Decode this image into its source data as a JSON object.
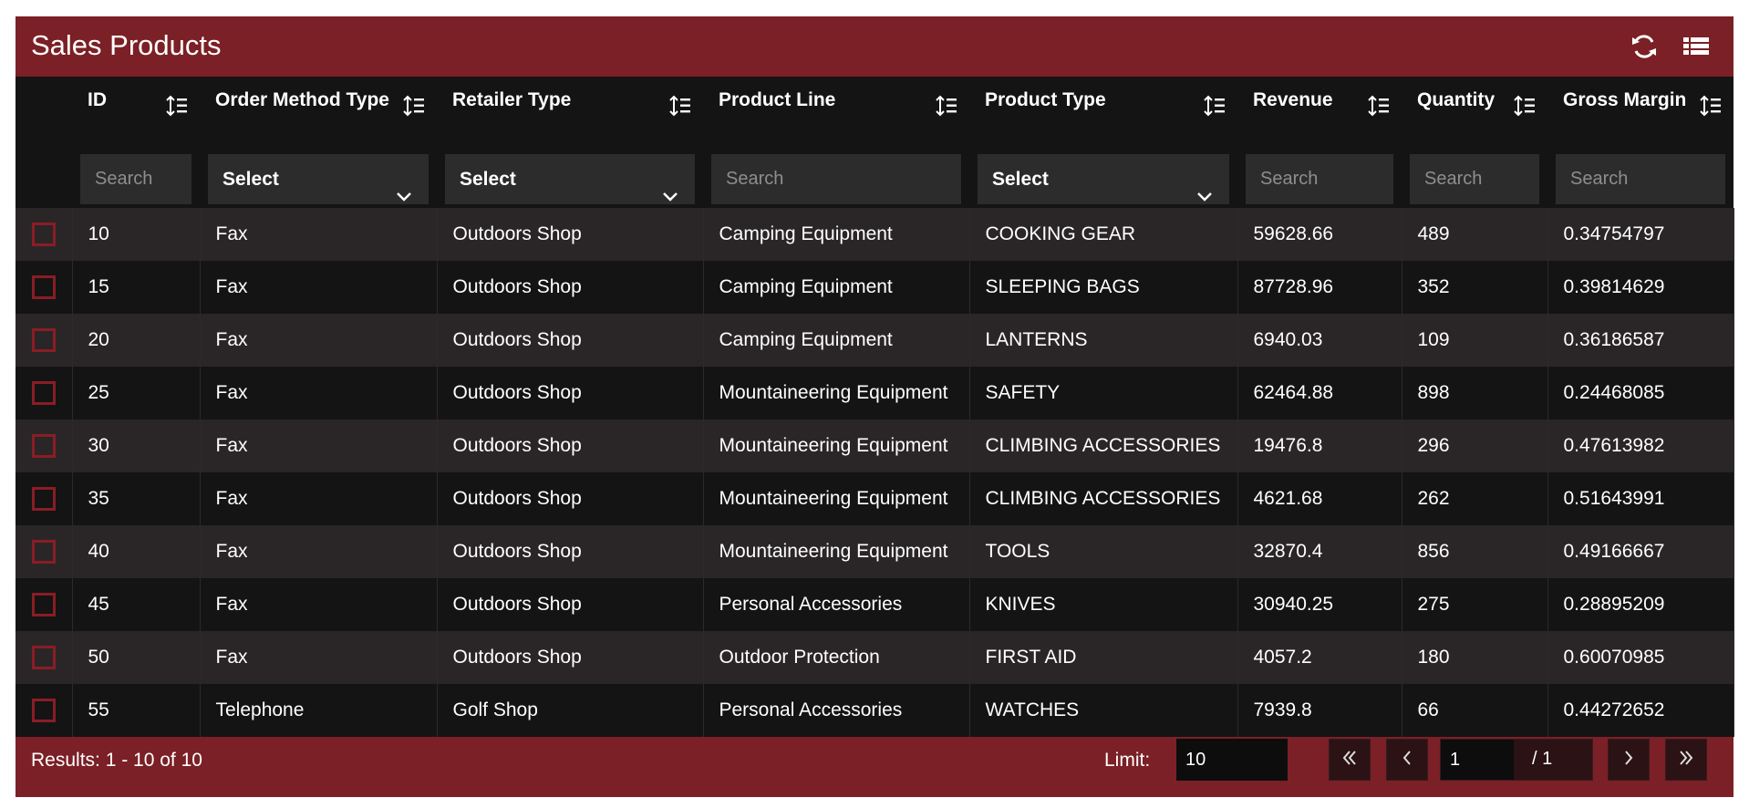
{
  "panel": {
    "title": "Sales Products"
  },
  "toolbar": {
    "refresh_icon": "refresh-icon",
    "view_icon": "list-view-icon"
  },
  "columns": [
    {
      "label": "ID",
      "filter": "input",
      "placeholder": "Search"
    },
    {
      "label": "Order Method Type",
      "filter": "select",
      "value": "Select"
    },
    {
      "label": "Retailer Type",
      "filter": "select",
      "value": "Select"
    },
    {
      "label": "Product Line",
      "filter": "input",
      "placeholder": "Search"
    },
    {
      "label": "Product Type",
      "filter": "select",
      "value": "Select"
    },
    {
      "label": "Revenue",
      "filter": "input",
      "placeholder": "Search"
    },
    {
      "label": "Quantity",
      "filter": "input",
      "placeholder": "Search"
    },
    {
      "label": "Gross Margin",
      "filter": "input",
      "placeholder": "Search"
    }
  ],
  "rows": [
    [
      "10",
      "Fax",
      "Outdoors Shop",
      "Camping Equipment",
      "COOKING GEAR",
      "59628.66",
      "489",
      "0.34754797"
    ],
    [
      "15",
      "Fax",
      "Outdoors Shop",
      "Camping Equipment",
      "SLEEPING BAGS",
      "87728.96",
      "352",
      "0.39814629"
    ],
    [
      "20",
      "Fax",
      "Outdoors Shop",
      "Camping Equipment",
      "LANTERNS",
      "6940.03",
      "109",
      "0.36186587"
    ],
    [
      "25",
      "Fax",
      "Outdoors Shop",
      "Mountaineering Equipment",
      "SAFETY",
      "62464.88",
      "898",
      "0.24468085"
    ],
    [
      "30",
      "Fax",
      "Outdoors Shop",
      "Mountaineering Equipment",
      "CLIMBING ACCESSORIES",
      "19476.8",
      "296",
      "0.47613982"
    ],
    [
      "35",
      "Fax",
      "Outdoors Shop",
      "Mountaineering Equipment",
      "CLIMBING ACCESSORIES",
      "4621.68",
      "262",
      "0.51643991"
    ],
    [
      "40",
      "Fax",
      "Outdoors Shop",
      "Mountaineering Equipment",
      "TOOLS",
      "32870.4",
      "856",
      "0.49166667"
    ],
    [
      "45",
      "Fax",
      "Outdoors Shop",
      "Personal Accessories",
      "KNIVES",
      "30940.25",
      "275",
      "0.28895209"
    ],
    [
      "50",
      "Fax",
      "Outdoors Shop",
      "Outdoor Protection",
      "FIRST AID",
      "4057.2",
      "180",
      "0.60070985"
    ],
    [
      "55",
      "Telephone",
      "Golf Shop",
      "Personal Accessories",
      "WATCHES",
      "7939.8",
      "66",
      "0.44272652"
    ]
  ],
  "footer": {
    "results": "Results: 1 - 10 of 10",
    "limit_label": "Limit:",
    "limit_value": "10",
    "page_value": "1",
    "page_total": "/ 1"
  },
  "colors": {
    "brand": "#7b2026",
    "grid_bg": "#141414",
    "row_alt": "#2a2628",
    "checkbox": "#8a1d25"
  }
}
